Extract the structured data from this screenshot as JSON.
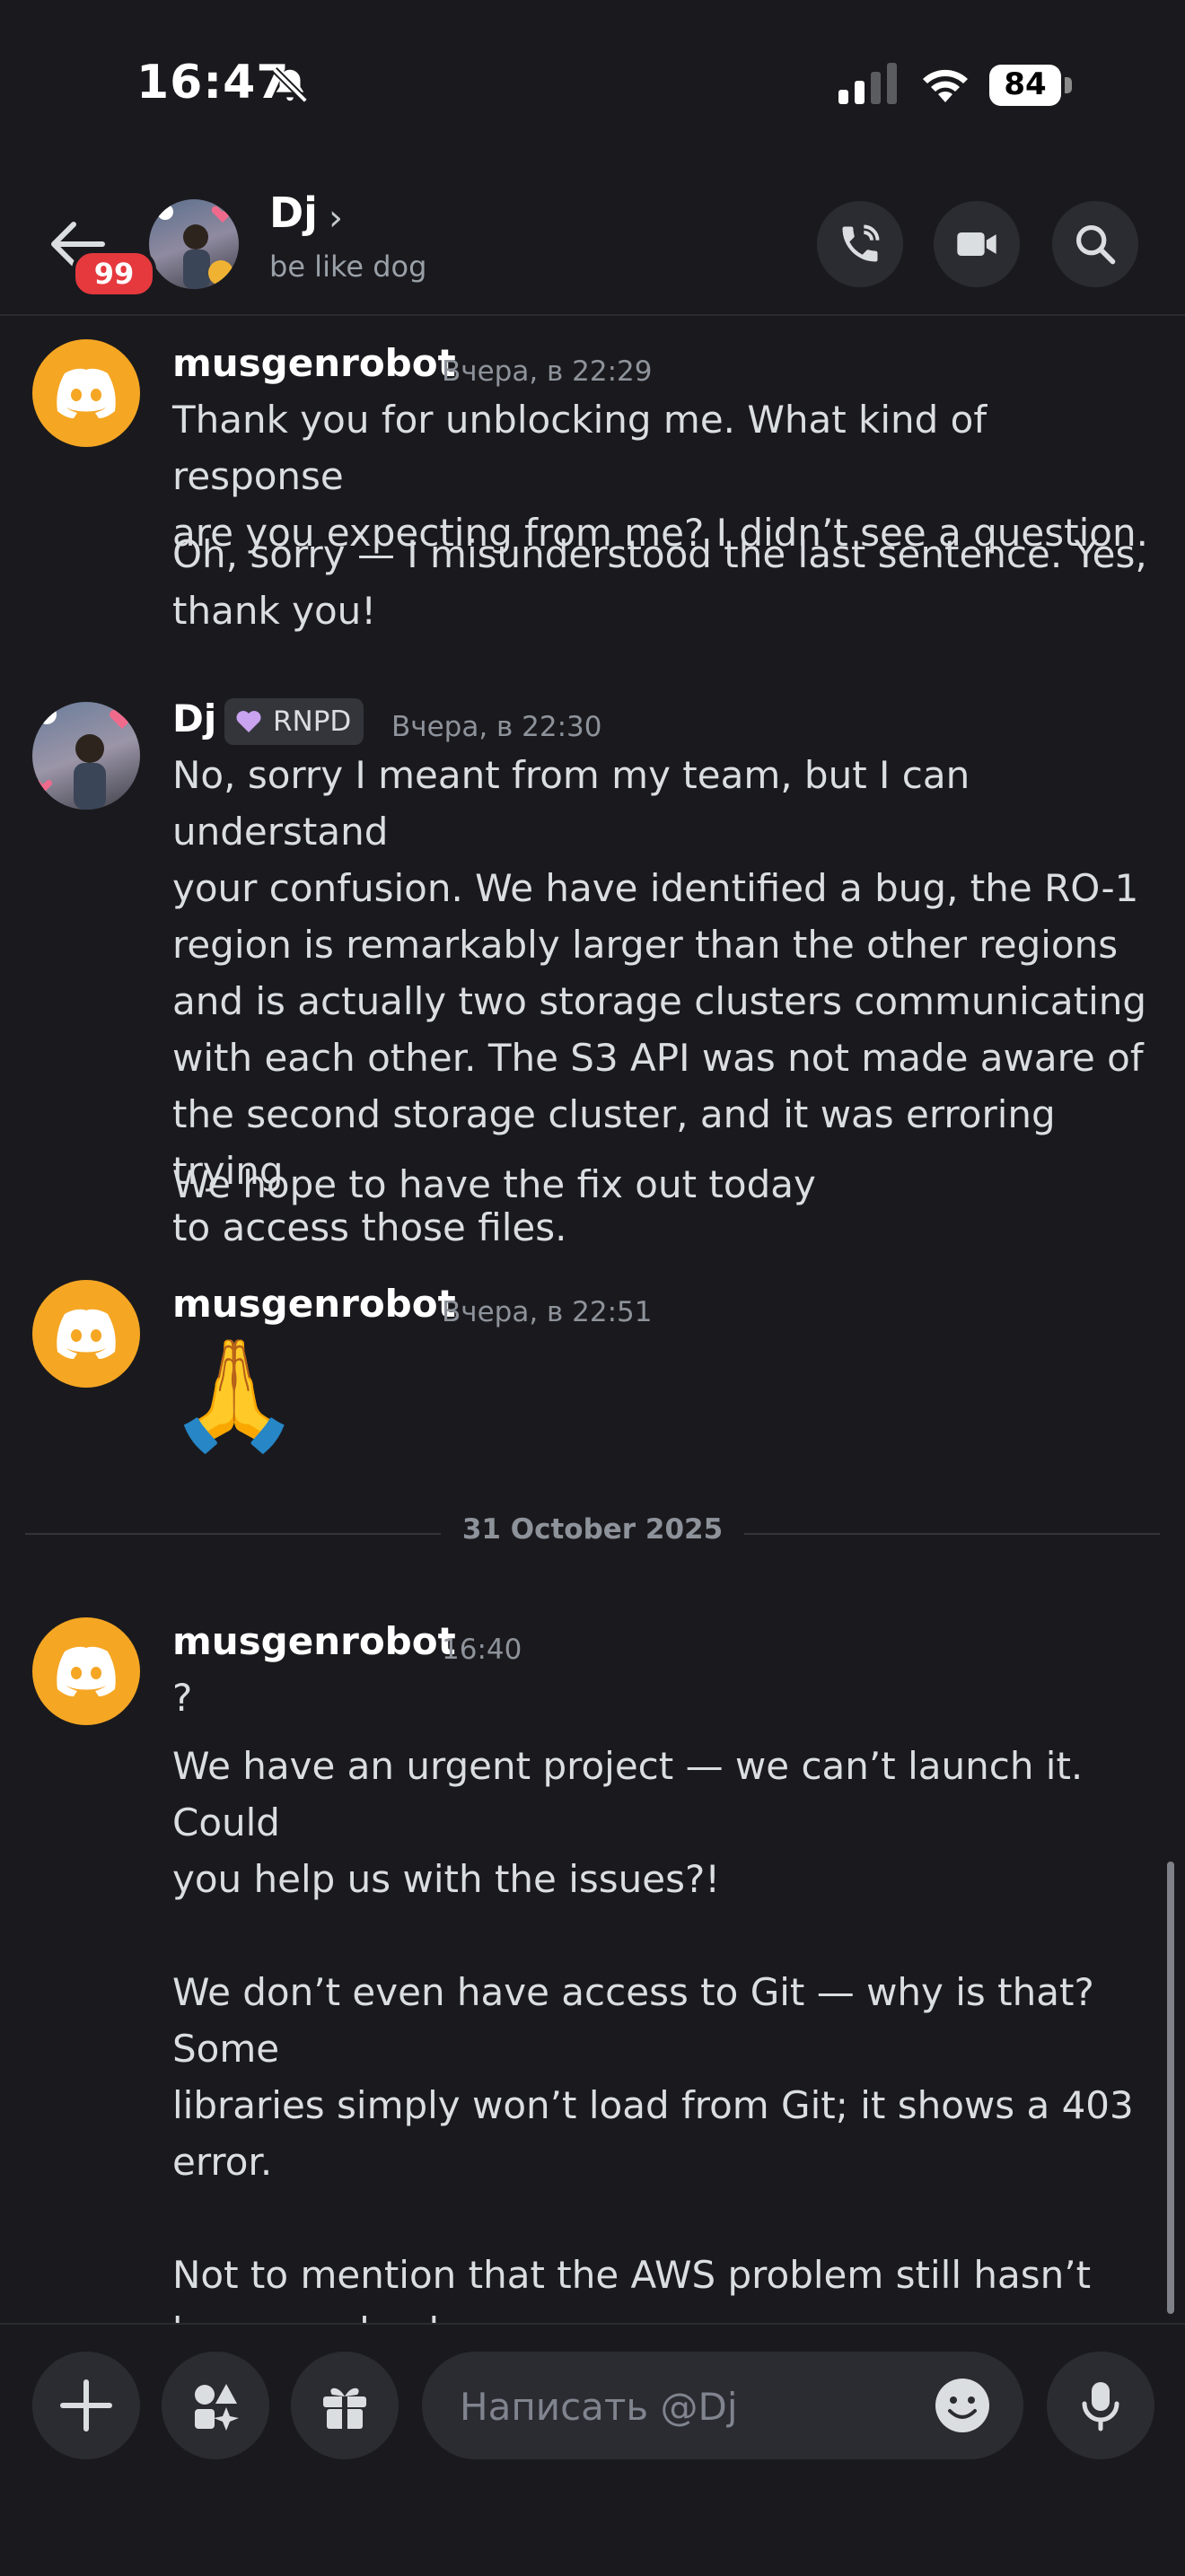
{
  "status_bar": {
    "time": "16:47",
    "battery": "84"
  },
  "header": {
    "unread_badge": "99",
    "name": "Dj",
    "status": "be like dog"
  },
  "messages": [
    {
      "author": "musgenrobot",
      "timestamp": "Вчера, в 22:29",
      "paragraphs": [
        "Thank you for unblocking me. What kind of response\nare you expecting from me? I didn’t see a question.",
        "Oh, sorry — I misunderstood the last sentence. Yes,\nthank you!"
      ]
    },
    {
      "author": "Dj",
      "role": "RNPD",
      "timestamp": "Вчера, в 22:30",
      "paragraphs": [
        "No, sorry I meant from my team, but I can understand\nyour confusion. We have identified a bug, the RO-1\nregion is remarkably larger than the other regions\nand is actually two storage clusters communicating\nwith each other. The S3 API was not made aware of\nthe second storage cluster, and it was erroring trying\nto access those files.",
        "We hope to have the fix out today"
      ]
    },
    {
      "author": "musgenrobot",
      "timestamp": "Вчера, в 22:51",
      "emoji": "🙏"
    },
    {
      "author": "musgenrobot",
      "timestamp": "16:40",
      "paragraphs": [
        "?",
        "We have an urgent project — we can’t launch it. Could\nyou help us with the issues?!\n\nWe don’t even have access to Git — why is that? Some\nlibraries simply won’t load from Git; it shows a 403\nerror.\n\nNot to mention that the AWS problem still hasn’t\nbeen resolved..."
      ]
    }
  ],
  "date_divider": "31 October 2025",
  "composer": {
    "placeholder": "Написать @Dj"
  },
  "colors": {
    "bot_avatar": "#f5a623",
    "badge": "#e5393e",
    "background": "#1a1a1e"
  }
}
